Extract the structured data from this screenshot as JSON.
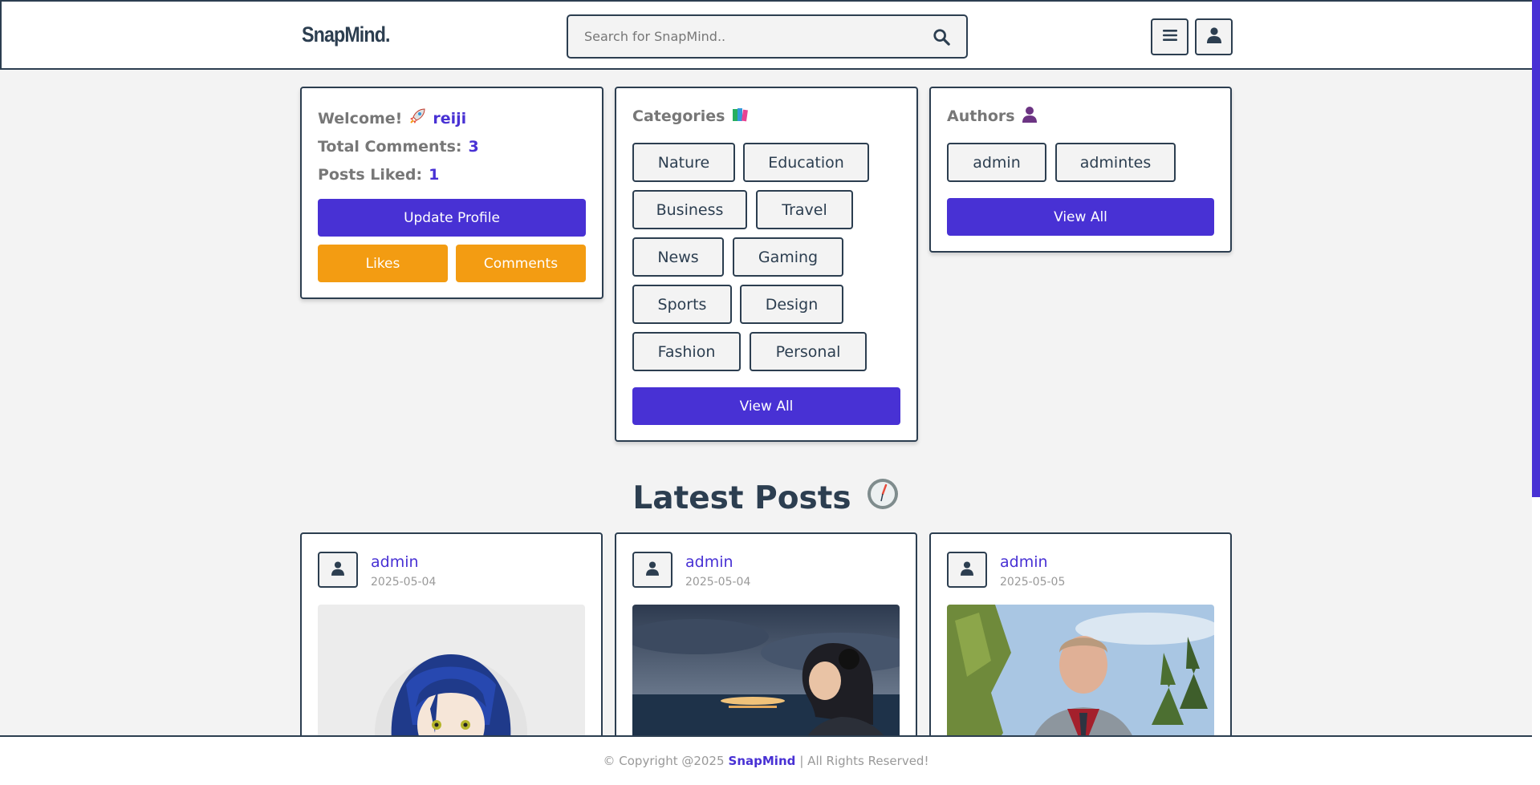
{
  "header": {
    "logo": "SnapMind.",
    "search_placeholder": "Search for SnapMind..",
    "icons": [
      "search-icon",
      "menu-icon",
      "user-icon"
    ]
  },
  "welcome": {
    "greeting": "Welcome!",
    "username": "reiji",
    "comments_label": "Total Comments:",
    "comments_count": "3",
    "liked_label": "Posts Liked:",
    "liked_count": "1",
    "update_profile": "Update Profile",
    "likes": "Likes",
    "comments": "Comments"
  },
  "categories": {
    "title": "Categories",
    "items": [
      "Nature",
      "Education",
      "Business",
      "Travel",
      "News",
      "Gaming",
      "Sports",
      "Design",
      "Fashion",
      "Personal"
    ],
    "view_all": "View All"
  },
  "authors": {
    "title": "Authors",
    "items": [
      "admin",
      "admintes"
    ],
    "view_all": "View All"
  },
  "latest": {
    "title": "Latest Posts",
    "posts": [
      {
        "author": "admin",
        "date": "2025-05-04"
      },
      {
        "author": "admin",
        "date": "2025-05-04"
      },
      {
        "author": "admin",
        "date": "2025-05-05"
      }
    ]
  },
  "footer": {
    "copyright": "© Copyright @2025",
    "brand": "SnapMind",
    "rights": "| All Rights Reserved!"
  },
  "colors": {
    "primary": "#4831d4",
    "secondary": "#f39c12",
    "text": "#2c3e50",
    "background": "#f3f3f3"
  }
}
